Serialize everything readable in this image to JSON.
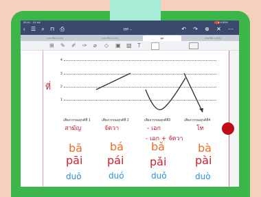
{
  "status": {
    "time": "09:41 · 15 Juli",
    "right": "● 9 89%"
  },
  "nav": {
    "left_icons": "‹ ☰ ⌕ ⊓ ⎙",
    "title": "ppt ⌄",
    "right_icons": "↶ ↷ ⊕ ✕ ⋯"
  },
  "tabs": [
    {
      "label": "ภาษาจีน 1 (1/1)"
    },
    {
      "label": "ภาษาจีน 1 (1/1)"
    },
    {
      "label": "ppt"
    },
    {
      "label": "ภาษาจีน 1 (1/1)"
    }
  ],
  "toolbar": {
    "tools": [
      "⊞",
      "✎",
      "✐",
      "✑",
      "⌀",
      "◇",
      "▣",
      "▧",
      "T"
    ]
  },
  "page": {
    "numbers": [
      "4",
      "3",
      "2",
      "1"
    ],
    "thai_left": "ที่",
    "headers": [
      "เสียงวรรณยุกต์ที่ 1",
      "เสียงวรรณยุกต์ที่ 2",
      "เสียงวรรณยุกต์ที่3",
      "เสียงวรรณยุกต์ที่4"
    ],
    "notes": {
      "c1": "สามัญ",
      "c2": "จัตวา",
      "c3a": "- เอก",
      "c3b": "- เอก + จัตวา",
      "c4": "โท"
    },
    "row_ba": [
      "bā",
      "bá",
      "bǎ",
      "bà"
    ],
    "row_pai": [
      "pāi",
      "pái",
      "pǎi",
      "pài"
    ],
    "row_duo": [
      "duō",
      "duó",
      "duǒ",
      "duò"
    ]
  },
  "colors": {
    "frame": "#3cb54a",
    "navbar": "#3a4a6f",
    "orange": "#ef6e23",
    "red": "#d0202f",
    "green": "#1ea94d",
    "blue": "#2b8fd6"
  }
}
